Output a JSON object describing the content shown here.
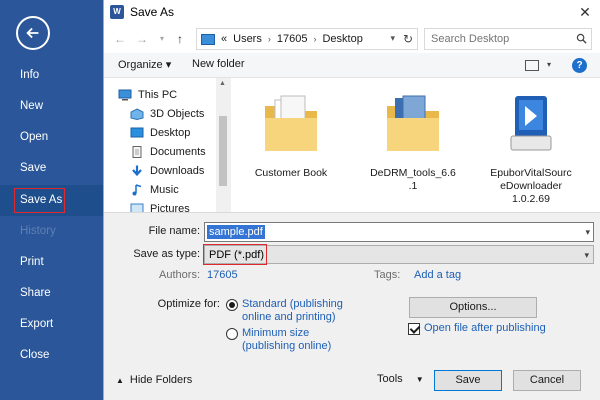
{
  "backstage": {
    "items": [
      {
        "label": "Info"
      },
      {
        "label": "New"
      },
      {
        "label": "Open"
      },
      {
        "label": "Save"
      },
      {
        "label": "Save As"
      },
      {
        "label": "History"
      },
      {
        "label": "Print"
      },
      {
        "label": "Share"
      },
      {
        "label": "Export"
      },
      {
        "label": "Close"
      }
    ],
    "bg_color": "#2b579a",
    "highlight_color": "#e0282e"
  },
  "dialog": {
    "title": "Save As",
    "address": {
      "prefix": "«",
      "crumbs": [
        "Users",
        "17605",
        "Desktop"
      ]
    },
    "search_placeholder": "Search Desktop",
    "toolbar": {
      "organize": "Organize ▾",
      "new_folder": "New folder"
    },
    "nav": [
      {
        "label": "This PC"
      },
      {
        "label": "3D Objects"
      },
      {
        "label": "Desktop"
      },
      {
        "label": "Documents"
      },
      {
        "label": "Downloads"
      },
      {
        "label": "Music"
      },
      {
        "label": "Pictures"
      }
    ],
    "files": [
      {
        "label": "Customer Book"
      },
      {
        "label": "DeDRM_tools_6.6\n.1"
      },
      {
        "label": "EpuborVitalSourc\neDownloader\n1.0.2.69"
      }
    ],
    "form": {
      "file_name_label": "File name:",
      "file_name_value": "sample.pdf",
      "save_type_label": "Save as type:",
      "save_type_value": "PDF (*.pdf)",
      "authors_label": "Authors:",
      "authors_value": "17605",
      "tags_label": "Tags:",
      "tags_value": "Add a tag",
      "optimize_label": "Optimize for:",
      "opt_standard": "Standard (publishing\nonline and printing)",
      "opt_minimum": "Minimum size\n(publishing online)",
      "options_button": "Options...",
      "open_after_label": "Open file after publishing",
      "hide_folders": "Hide Folders",
      "tools": "Tools",
      "save_button": "Save",
      "cancel_button": "Cancel"
    }
  }
}
